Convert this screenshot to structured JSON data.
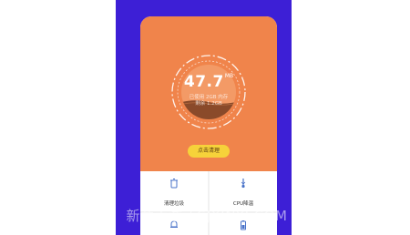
{
  "gauge": {
    "value": "47.7",
    "unit": "MB",
    "subtitle_1": "已使用 2GB 内存",
    "subtitle_2": "剩余 1.2GB"
  },
  "actions": {
    "clean_button": "点击清理"
  },
  "tiles": [
    {
      "label": "清理垃圾",
      "icon": "trash-icon"
    },
    {
      "label": "CPU降温",
      "icon": "thermometer-icon"
    },
    {
      "label": "",
      "icon": "bell-icon"
    },
    {
      "label": "",
      "icon": "battery-icon"
    }
  ],
  "watermark": "新意手游 / SJXINYI.COM",
  "colors": {
    "background_band": "#3d1fd6",
    "hero": "#f0844b",
    "button": "#f6d23a",
    "liquid": "#8a4a2a"
  }
}
